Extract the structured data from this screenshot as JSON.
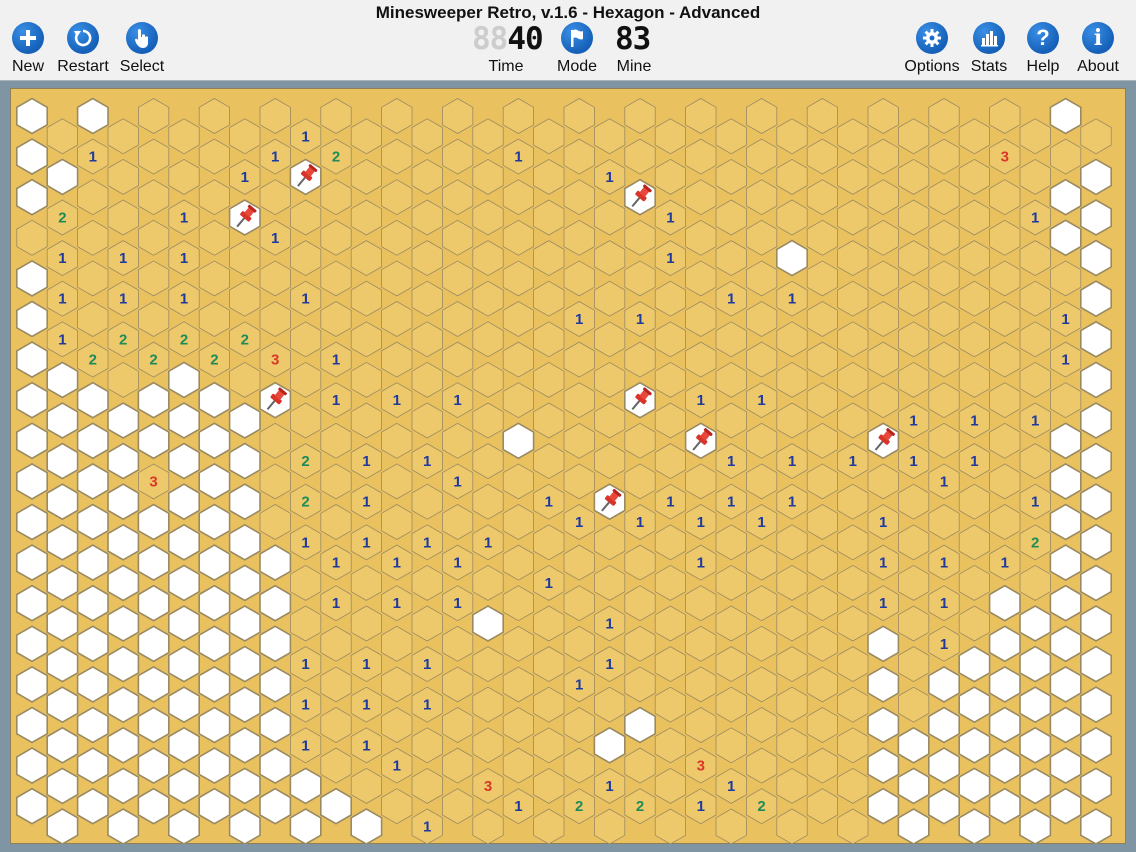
{
  "window": {
    "title": "Minesweeper Retro, v.1.6 - Hexagon - Advanced"
  },
  "toolbar": {
    "left_buttons": [
      {
        "id": "new",
        "label": "New",
        "icon": "plus-icon"
      },
      {
        "id": "restart",
        "label": "Restart",
        "icon": "restart-icon"
      },
      {
        "id": "select",
        "label": "Select",
        "icon": "pointer-hand-icon"
      }
    ],
    "right_buttons": [
      {
        "id": "options",
        "label": "Options",
        "icon": "gear-icon"
      },
      {
        "id": "stats",
        "label": "Stats",
        "icon": "bar-chart-icon"
      },
      {
        "id": "help",
        "label": "Help",
        "icon": "question-icon"
      },
      {
        "id": "about",
        "label": "About",
        "icon": "info-icon"
      }
    ],
    "time": {
      "label": "Time",
      "display_dim": "88",
      "display_value": "40"
    },
    "mode": {
      "label": "Mode",
      "icon": "flag-icon"
    },
    "mine": {
      "label": "Mine",
      "display_value": "83"
    }
  },
  "colors": {
    "revealed": "#f3cf74",
    "covered": "#ffffff",
    "grid_line": "#9a8a62",
    "number_1": "#1f3a9e",
    "number_2": "#1e8c5a",
    "number_3": "#d8382a",
    "button_blue": "#1a6ad0",
    "board_background": "#e9c15f"
  },
  "board": {
    "type": "hexagon",
    "columns": 36,
    "rows": 18,
    "legend": {
      "U": "covered",
      "O": "revealed",
      "F": "flag",
      "1": "one",
      "2": "two",
      "3": "three"
    },
    "grid": [
      "UOUOOOOOO1OOOOOOOOOOOOOOOOOOOOOOOOUO",
      "UU1OOOO11F2OOOOO1OO1OOOOOOOOOOOO3OOU",
      "U2OOO1OFOOOOOOOOOOOOF1OOOOOOOOOOO1UU",
      "O1O1O1OO1OOOOOOOOOOOO1OOOUOOOOOOOOUU",
      "U1O1O1OOO1OOOOOOOOOOOOO1O1OOOOOOOOOU",
      "U1O2O2O2OOOOOOOOOO1O1OOOOOOOOOOOOO1U",
      "UU2O2U2O3O1OOOOOOOOOOOOOOOOOOOOOOO1U",
      "UUUUUUUUFO1O1O1OOOOOFO1O1OOOO1O1O1OU",
      "UUUUUUUUO2O1O1OOUOOOOOF1O1O1F1O1OOUU",
      "UUUU3UUUO2O1OO1OO1OFO1O1O1OOOO1OO1UU",
      "UUUUUUUUO1O1O1O1OO1O1O1O1OOO1OOOO2UU",
      "UUUUUUUUUO1O1O1OO1OOOO1OOOOO1O1O1OUU",
      "UUUUUUUUUO1O1O1UOOO1OOOOOOOO1O1OUUUU",
      "UUUUUUUUU1O1O1OOOOO1OOOOOOOOUO1UUUUU",
      "UUUUUUUUU1O1O1OOOO1OOOOOOOOOUOUUUUUU",
      "UUUUUUUUU1O1OOOOOOOUUOOOOOOOUUUUUUUU",
      "UUUUUUUUUUOO1OO3OOO1OO31OOOOUUUUUUUU",
      "UUUUUUUUUUUUO1OO1O2O2O1O2OOOUUUUUUUU"
    ]
  }
}
